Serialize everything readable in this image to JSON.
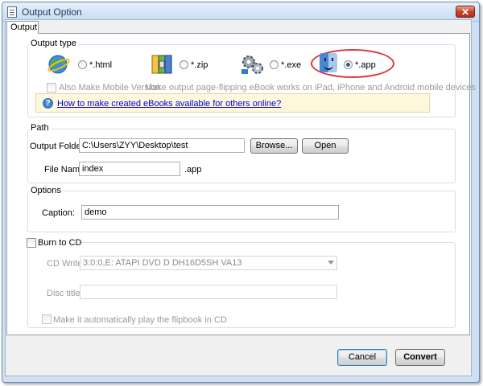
{
  "window": {
    "title": "Output Option",
    "close_glyph": "✕"
  },
  "tabs": [
    {
      "label": "Output"
    }
  ],
  "output_type": {
    "legend": "Output type",
    "options": [
      {
        "label": "*.html",
        "icon": "globe-icon"
      },
      {
        "label": "*.zip",
        "icon": "zip-archive-icon"
      },
      {
        "label": "*.exe",
        "icon": "gears-icon"
      },
      {
        "label": "*.app",
        "icon": "mac-finder-icon",
        "selected": true
      }
    ],
    "mobile": {
      "label": "Also Make Mobile Version",
      "hint": "Make output page-flipping eBook works on iPad, iPhone and Android mobile devices"
    },
    "help_link": "How to make created eBooks available for others online?"
  },
  "path": {
    "legend": "Path",
    "output_folder_label": "Output Folder:",
    "output_folder_value": "C:\\Users\\ZYY\\Desktop\\test",
    "browse_label": "Browse...",
    "open_label": "Open",
    "file_name_label": "File Name:",
    "file_name_value": "index",
    "extension": ".app"
  },
  "options": {
    "legend": "Options",
    "caption_label": "Caption:",
    "caption_value": "demo"
  },
  "burn": {
    "legend": "Burn to CD",
    "cd_writer_label": "CD Writer",
    "cd_writer_value": "3:0:0,E: ATAPI   DVD D  DH16D5SH  VA13",
    "disc_title_label": "Disc title:",
    "disc_title_value": "",
    "autoplay_label": "Make it automatically play the flipbook in CD"
  },
  "footer": {
    "cancel_label": "Cancel",
    "convert_label": "Convert"
  },
  "colors": {
    "highlight_ring": "#d8363a",
    "link": "#0000e0",
    "titlebar": "#c7dbf1"
  }
}
